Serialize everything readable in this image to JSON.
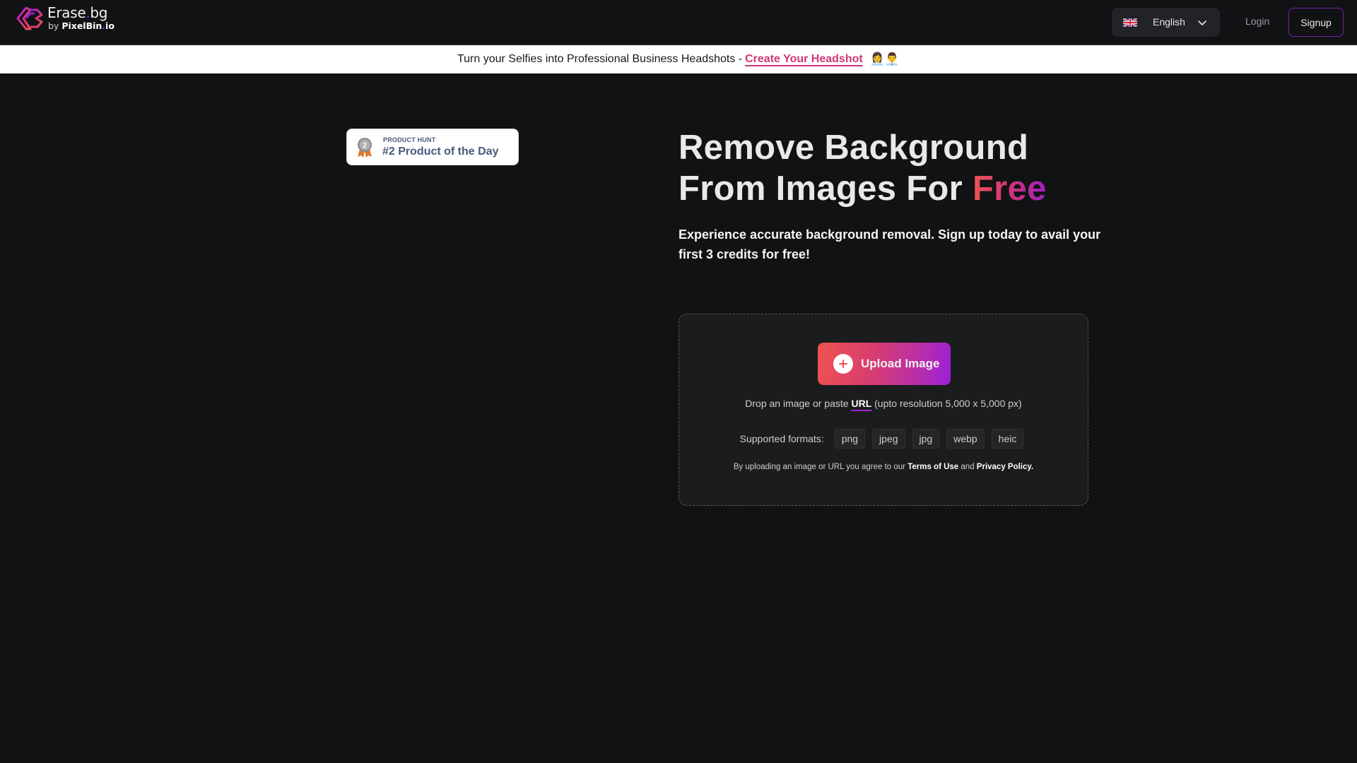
{
  "header": {
    "logo": {
      "title_main": "Erase",
      "title_dot": ".",
      "title_end": "bg",
      "sub_prefix": "by ",
      "sub_brand": "PixelBin",
      "sub_dot": ".",
      "sub_end": "io",
      "icon": "erase-bg-logo-icon"
    },
    "language": {
      "flag_icon": "uk-flag-icon",
      "selected": "English",
      "chevron_icon": "chevron-down-icon"
    },
    "login_label": "Login",
    "signup_label": "Signup"
  },
  "banner": {
    "text": "Turn your Selfies into Professional Business Headshots -",
    "link_label": "Create Your Headshot",
    "emoji": "👩‍💼👨‍💼"
  },
  "product_hunt": {
    "kicker": "PRODUCT HUNT",
    "title": "#2 Product of the Day",
    "rank": "2",
    "icon": "medal-icon"
  },
  "hero": {
    "title_line1": "Remove Background",
    "title_line2_prefix": "From Images For ",
    "title_highlight": "Free",
    "subtitle": "Experience accurate background removal. Sign up today to avail your first 3 credits for free!"
  },
  "upload": {
    "button_label": "Upload Image",
    "button_icon": "plus-icon",
    "drop_prefix": "Drop an image or paste ",
    "drop_link": "URL",
    "drop_suffix": " (upto resolution 5,000 x 5,000 px)",
    "formats_label": "Supported formats:",
    "formats": [
      "png",
      "jpeg",
      "jpg",
      "webp",
      "heic"
    ],
    "terms_prefix": "By uploading an image or URL you agree to our ",
    "terms_link": "Terms of Use",
    "terms_middle": " and ",
    "privacy_link": "Privacy Policy."
  },
  "colors": {
    "background": "#111214",
    "accent_purple": "#a020d8",
    "accent_red": "#ef5350",
    "accent_pink": "#d0357a",
    "badge_text": "#4b587c"
  }
}
